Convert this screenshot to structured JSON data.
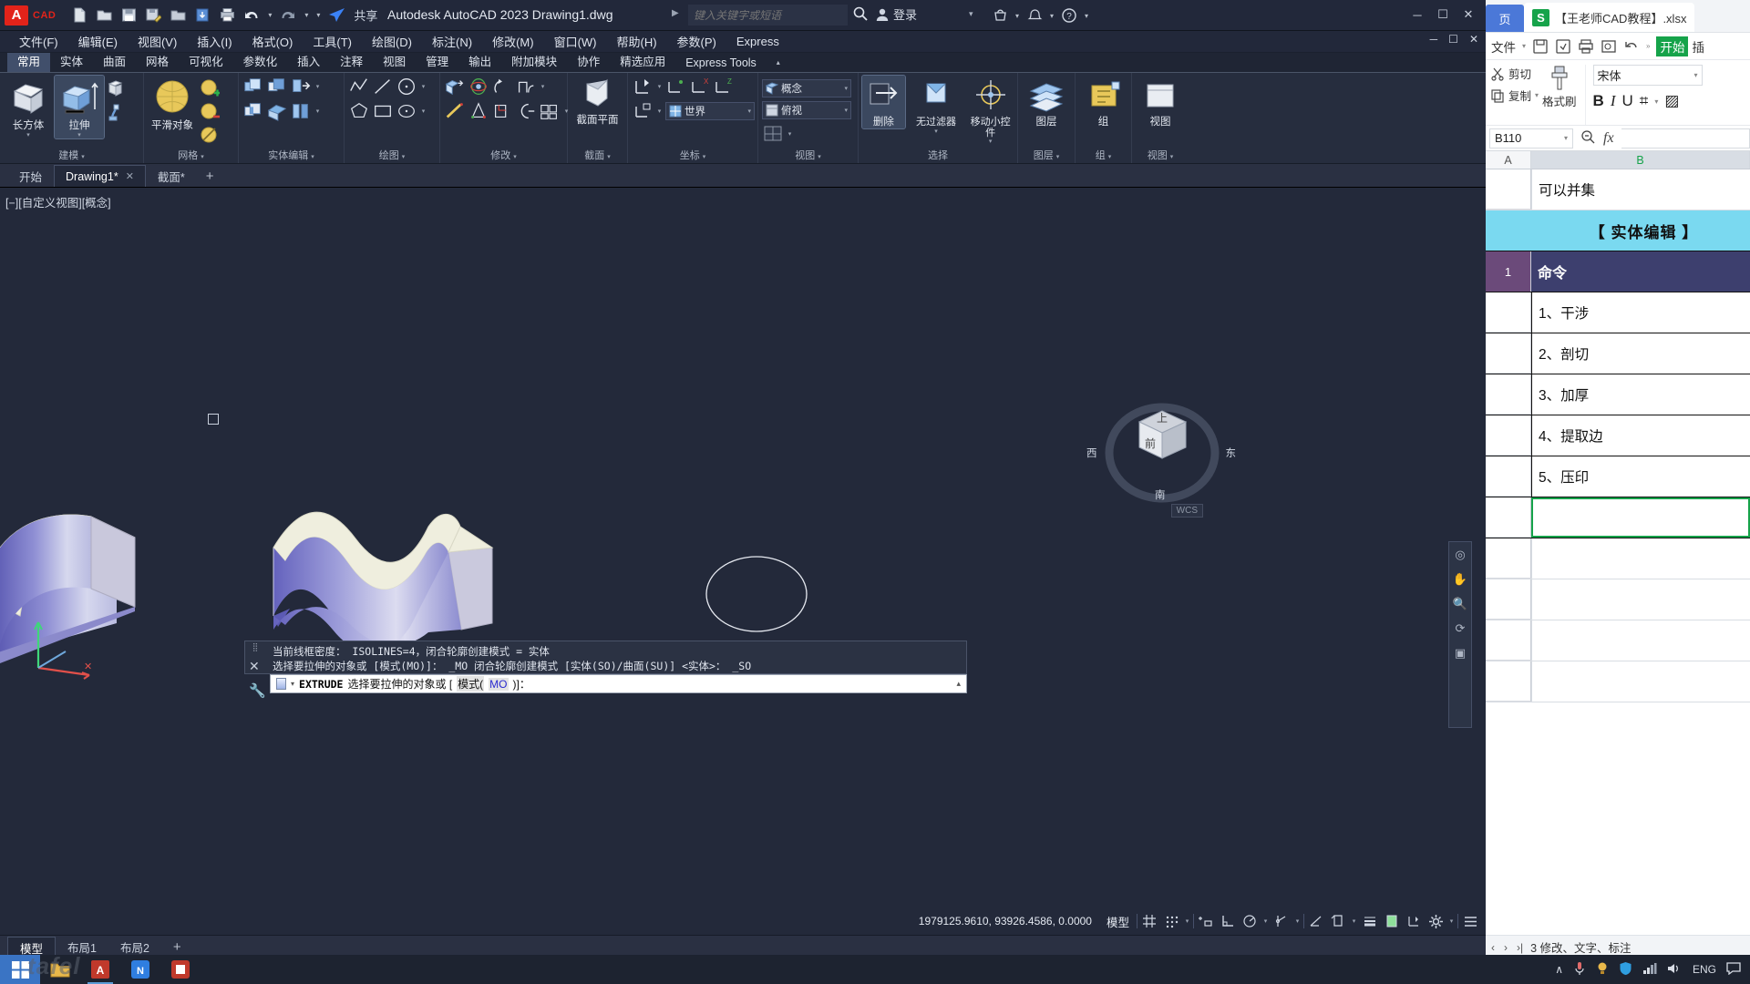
{
  "cad": {
    "title": "Autodesk AutoCAD 2023   Drawing1.dwg",
    "app_name": "Autodesk AutoCAD 2023",
    "doc_name": "Drawing1.dwg",
    "logo_letter": "A",
    "logo_word": "CAD",
    "quick_access": [
      {
        "name": "new-icon",
        "glyph": "Ὄ4"
      },
      {
        "name": "open-icon",
        "glyph": "📂"
      },
      {
        "name": "save-icon",
        "glyph": "💾"
      },
      {
        "name": "save-as-icon",
        "glyph": "💾"
      },
      {
        "name": "plot-preview-icon",
        "glyph": "📁"
      },
      {
        "name": "export-icon",
        "glyph": "⬇"
      },
      {
        "name": "print-icon",
        "glyph": "🖨"
      },
      {
        "name": "undo-icon",
        "glyph": "↶"
      },
      {
        "name": "redo-icon",
        "glyph": "↷"
      }
    ],
    "share_label": "共享",
    "search": {
      "placeholder": "键入关键字或短语",
      "value": ""
    },
    "signin_label": "登录",
    "window_buttons": {
      "minimize": "─",
      "maximize": "☐",
      "close": "✕"
    },
    "menu": [
      "文件(F)",
      "编辑(E)",
      "视图(V)",
      "插入(I)",
      "格式(O)",
      "工具(T)",
      "绘图(D)",
      "标注(N)",
      "修改(M)",
      "窗口(W)",
      "帮助(H)",
      "参数(P)",
      "Express"
    ],
    "ribbon_tabs": [
      {
        "label": "常用",
        "active": true
      },
      {
        "label": "实体",
        "active": false
      },
      {
        "label": "曲面",
        "active": false
      },
      {
        "label": "网格",
        "active": false
      },
      {
        "label": "可视化",
        "active": false
      },
      {
        "label": "参数化",
        "active": false
      },
      {
        "label": "插入",
        "active": false
      },
      {
        "label": "注释",
        "active": false
      },
      {
        "label": "视图",
        "active": false
      },
      {
        "label": "管理",
        "active": false
      },
      {
        "label": "输出",
        "active": false
      },
      {
        "label": "附加模块",
        "active": false
      },
      {
        "label": "协作",
        "active": false
      },
      {
        "label": "精选应用",
        "active": false
      },
      {
        "label": "Express Tools",
        "active": false
      }
    ],
    "panels": {
      "modeling": {
        "label": "建模",
        "box_label": "长方体",
        "extrude_label": "拉伸"
      },
      "mesh": {
        "label": "网格",
        "smooth_label": "平滑对象"
      },
      "solid_edit": {
        "label": "实体编辑"
      },
      "draw": {
        "label": "绘图"
      },
      "modify": {
        "label": "修改"
      },
      "section": {
        "label": "截面",
        "button_label": "截面平面"
      },
      "coords": {
        "label": "坐标",
        "world_value": "世界"
      },
      "view": {
        "label": "视图",
        "visual_style": "概念",
        "viewpoint": "俯视"
      },
      "selection": {
        "label": "选择",
        "erase_label": "删除",
        "filter_label": "无过滤器",
        "gizmo_label": "移动小控件"
      },
      "layers": {
        "label": "图层"
      },
      "group": {
        "label": "组"
      },
      "viewport": {
        "label": "视图"
      }
    },
    "file_tabs": [
      {
        "label": "开始",
        "active": false,
        "closable": false
      },
      {
        "label": "Drawing1*",
        "active": true,
        "closable": true
      },
      {
        "label": "截面*",
        "active": false,
        "closable": false
      }
    ],
    "file_tab_add": "+",
    "viewport_label": "[−][自定义视图][概念]",
    "viewcube": {
      "top": "上",
      "front": "前",
      "east": "东",
      "west": "西",
      "south": "南",
      "wcs": "WCS"
    },
    "command_history": [
      "当前线框密度：  ISOLINES=4，闭合轮廓创建模式 = 实体",
      "选择要拉伸的对象或 [模式(MO)]： _MO 闭合轮廓创建模式 [实体(SO)/曲面(SU)] <实体>： _SO"
    ],
    "command_prompt": {
      "command": "EXTRUDE",
      "text_before": "选择要拉伸的对象或 [",
      "option_label": "模式(",
      "option_key": "MO",
      "text_after": ")]："
    },
    "layout_tabs": [
      {
        "label": "模型",
        "active": true
      },
      {
        "label": "布局1",
        "active": false
      },
      {
        "label": "布局2",
        "active": false
      }
    ],
    "layout_add": "+",
    "status": {
      "coordinates": "1979125.9610, 93926.4586, 0.0000",
      "space_label": "模型"
    }
  },
  "excel": {
    "prev_tab": "页",
    "doc_title": "【王老师CAD教程】.xlsx",
    "file_menu": "文件",
    "ribbon_tabs": [
      {
        "label": "开始",
        "active": true
      },
      {
        "label": "插",
        "active": false
      }
    ],
    "clipboard": {
      "cut": "剪切",
      "copy": "复制",
      "format_painter": "格式刷"
    },
    "font_name": "宋体",
    "format_buttons": [
      "B",
      "I",
      "U",
      "⌗",
      "▨"
    ],
    "name_box": "B110",
    "formula_value": "",
    "columns": [
      "A",
      "B"
    ],
    "rows": [
      {
        "header": "",
        "value": "可以并集",
        "style": "plain"
      },
      {
        "header": "",
        "value": "【 实体编辑 】",
        "style": "title"
      },
      {
        "header": "1",
        "value": "命令",
        "style": "hdr"
      },
      {
        "header": "",
        "value": "1、干涉",
        "style": "plain"
      },
      {
        "header": "",
        "value": "2、剖切",
        "style": "plain"
      },
      {
        "header": "",
        "value": "3、加厚",
        "style": "plain"
      },
      {
        "header": "",
        "value": "4、提取边",
        "style": "plain"
      },
      {
        "header": "",
        "value": "5、压印",
        "style": "plain"
      },
      {
        "header": "",
        "value": "",
        "style": "sel"
      },
      {
        "header": "",
        "value": "",
        "style": "empty"
      },
      {
        "header": "",
        "value": "",
        "style": "empty"
      },
      {
        "header": "",
        "value": "",
        "style": "empty"
      },
      {
        "header": "",
        "value": "",
        "style": "empty"
      }
    ],
    "status_text": "3 修改、文字、标注"
  },
  "taskbar": {
    "start_glyph": "⊞",
    "apps": [
      "file-explorer",
      "autocad",
      "wps-writer",
      "wps-spreadsheet"
    ],
    "tray": {
      "chevron": "∧",
      "mic": "🎤",
      "shield": "🛡",
      "net": "📶",
      "volume": "🔊",
      "lang": "ENG",
      "notif": "💬"
    }
  },
  "colors": {
    "cad_bg": "#23293a",
    "ribbon_bg": "#262d3e",
    "accent_red": "#e2231a",
    "excel_green": "#16a34a",
    "title_cyan": "#7ad9f0",
    "header_purple": "#3d3f6e",
    "row_purple": "#6b4a7a"
  },
  "watermark": "tafel"
}
